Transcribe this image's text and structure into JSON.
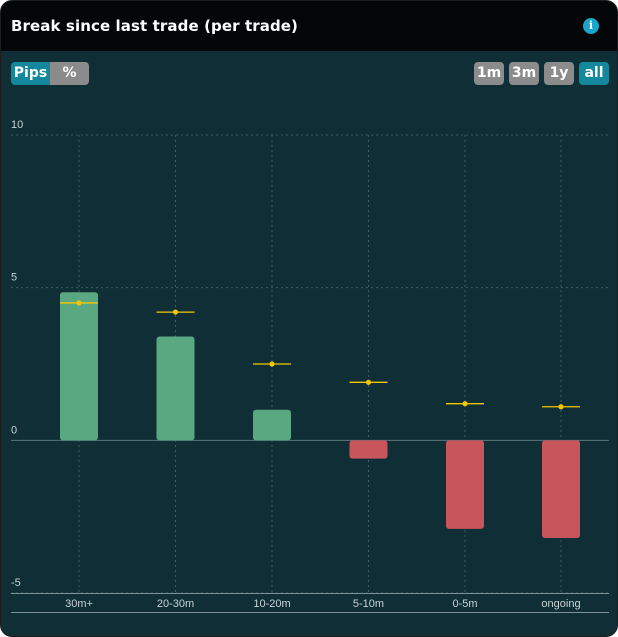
{
  "header": {
    "title": "Break since last trade (per trade)",
    "info_icon": "info-icon"
  },
  "unit_toggle": {
    "options": [
      "Pips",
      "%"
    ],
    "selected": "Pips"
  },
  "period_toggle": {
    "options": [
      "1m",
      "3m",
      "1y",
      "all"
    ],
    "selected": "all"
  },
  "colors": {
    "positive": "#5aa881",
    "negative": "#c8555a",
    "marker": "#f5c800",
    "background": "#0f2e36"
  },
  "chart_data": {
    "type": "bar",
    "categories": [
      "30m+",
      "20-30m",
      "10-20m",
      "5-10m",
      "0-5m",
      "ongoing"
    ],
    "values": [
      4.85,
      3.4,
      1.0,
      -0.6,
      -2.9,
      -3.2
    ],
    "markers": [
      4.5,
      4.2,
      2.5,
      1.9,
      1.2,
      1.1
    ],
    "ylim": [
      -5,
      10
    ],
    "yticks": [
      10,
      5,
      0,
      -5
    ],
    "grid": true
  }
}
